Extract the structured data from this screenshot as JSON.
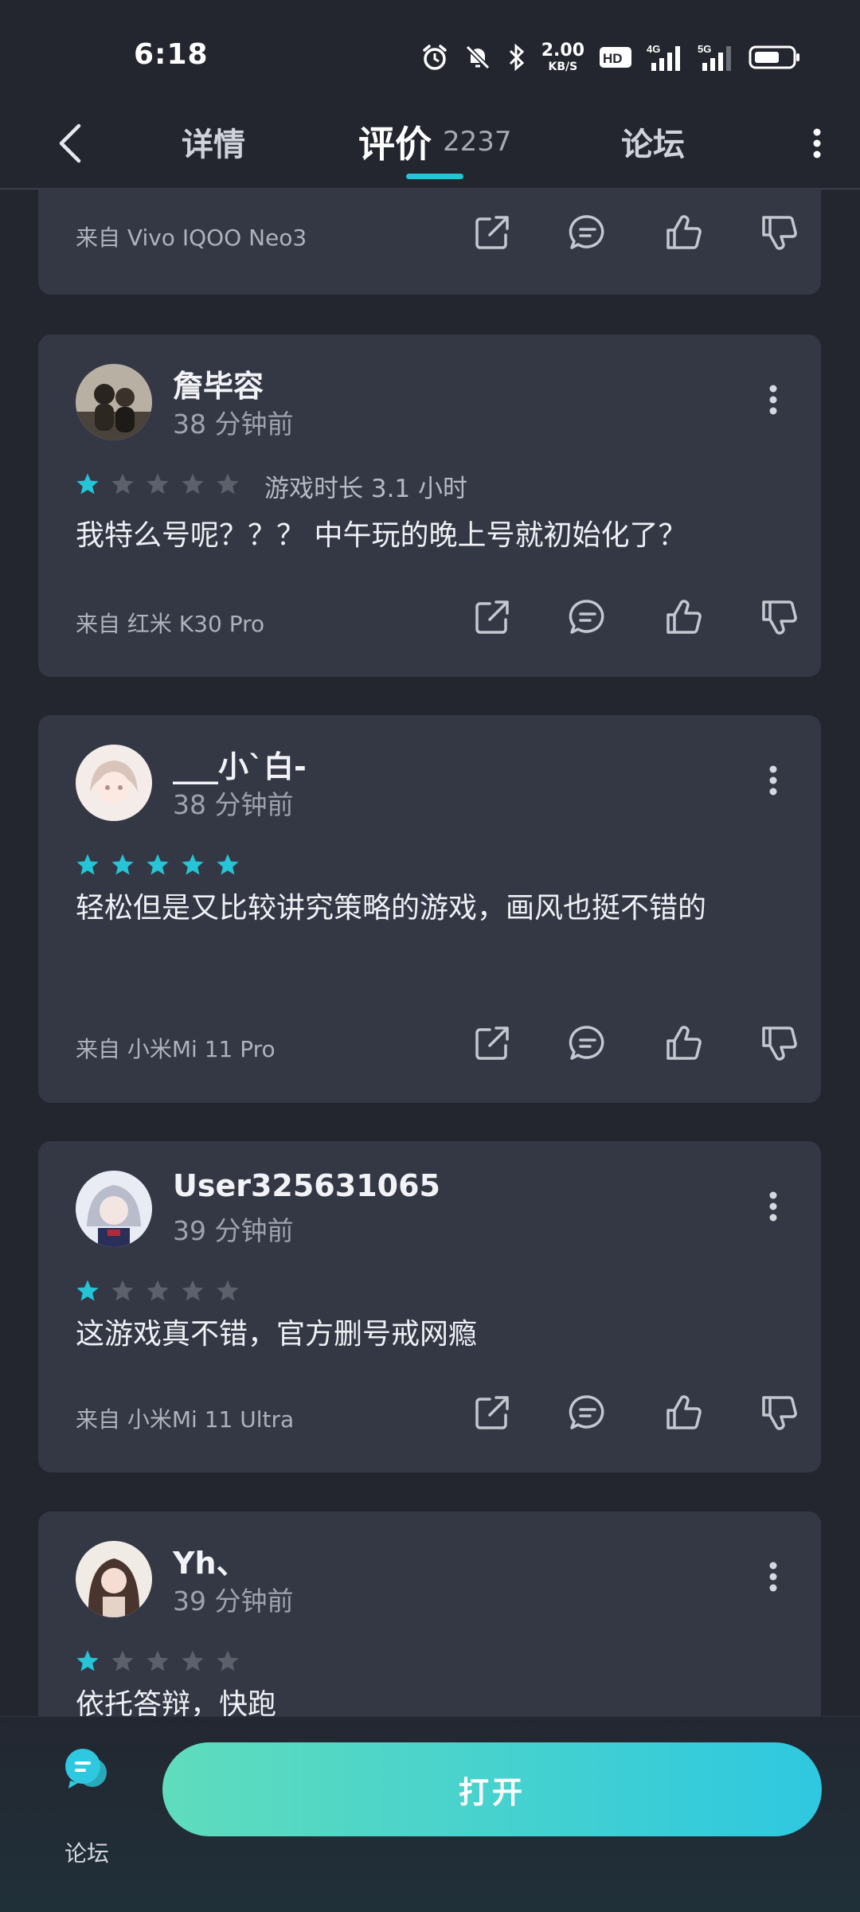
{
  "status_bar": {
    "time": "6:18",
    "net_speed_value": "2.00",
    "net_speed_unit": "KB/S",
    "icons": [
      "alarm-icon",
      "mute-icon",
      "bluetooth-icon",
      "hd-icon",
      "signal-4g-icon",
      "signal-5g-icon",
      "battery-icon"
    ]
  },
  "nav": {
    "back_icon": "back-arrow-icon",
    "tabs": [
      {
        "label": "详情",
        "count": ""
      },
      {
        "label": "评价",
        "count": "2237"
      },
      {
        "label": "论坛",
        "count": ""
      }
    ],
    "active_tab": "评价",
    "accent_color": "#25c4d6"
  },
  "reviews": [
    {
      "partial": true,
      "device": "来自 Vivo IQOO Neo3"
    },
    {
      "username": "詹毕容",
      "time": "38 分钟前",
      "rating": 1,
      "playtime": "游戏时长 3.1 小时",
      "text": "我特么号呢？？？ 中午玩的晚上号就初始化了？",
      "device": "来自 红米 K30 Pro"
    },
    {
      "username": "___小`白-",
      "time": "38 分钟前",
      "rating": 5,
      "playtime": "",
      "text": "轻松但是又比较讲究策略的游戏，画风也挺不错的",
      "device": "来自 小米Mi 11 Pro"
    },
    {
      "username": "User325631065",
      "time": "39 分钟前",
      "rating": 1,
      "playtime": "",
      "text": "这游戏真不错，官方删号戒网瘾",
      "device": "来自 小米Mi 11 Ultra"
    },
    {
      "username": "Yh、",
      "time": "39 分钟前",
      "rating": 1,
      "playtime": "",
      "text": "依托答辩，快跑",
      "device": ""
    }
  ],
  "colors": {
    "background": "#23262f",
    "card": "#343845",
    "star_filled": "#25c4d6",
    "star_empty": "#5c606b"
  },
  "bottom_bar": {
    "forum_label": "论坛",
    "open_label": "打开"
  }
}
